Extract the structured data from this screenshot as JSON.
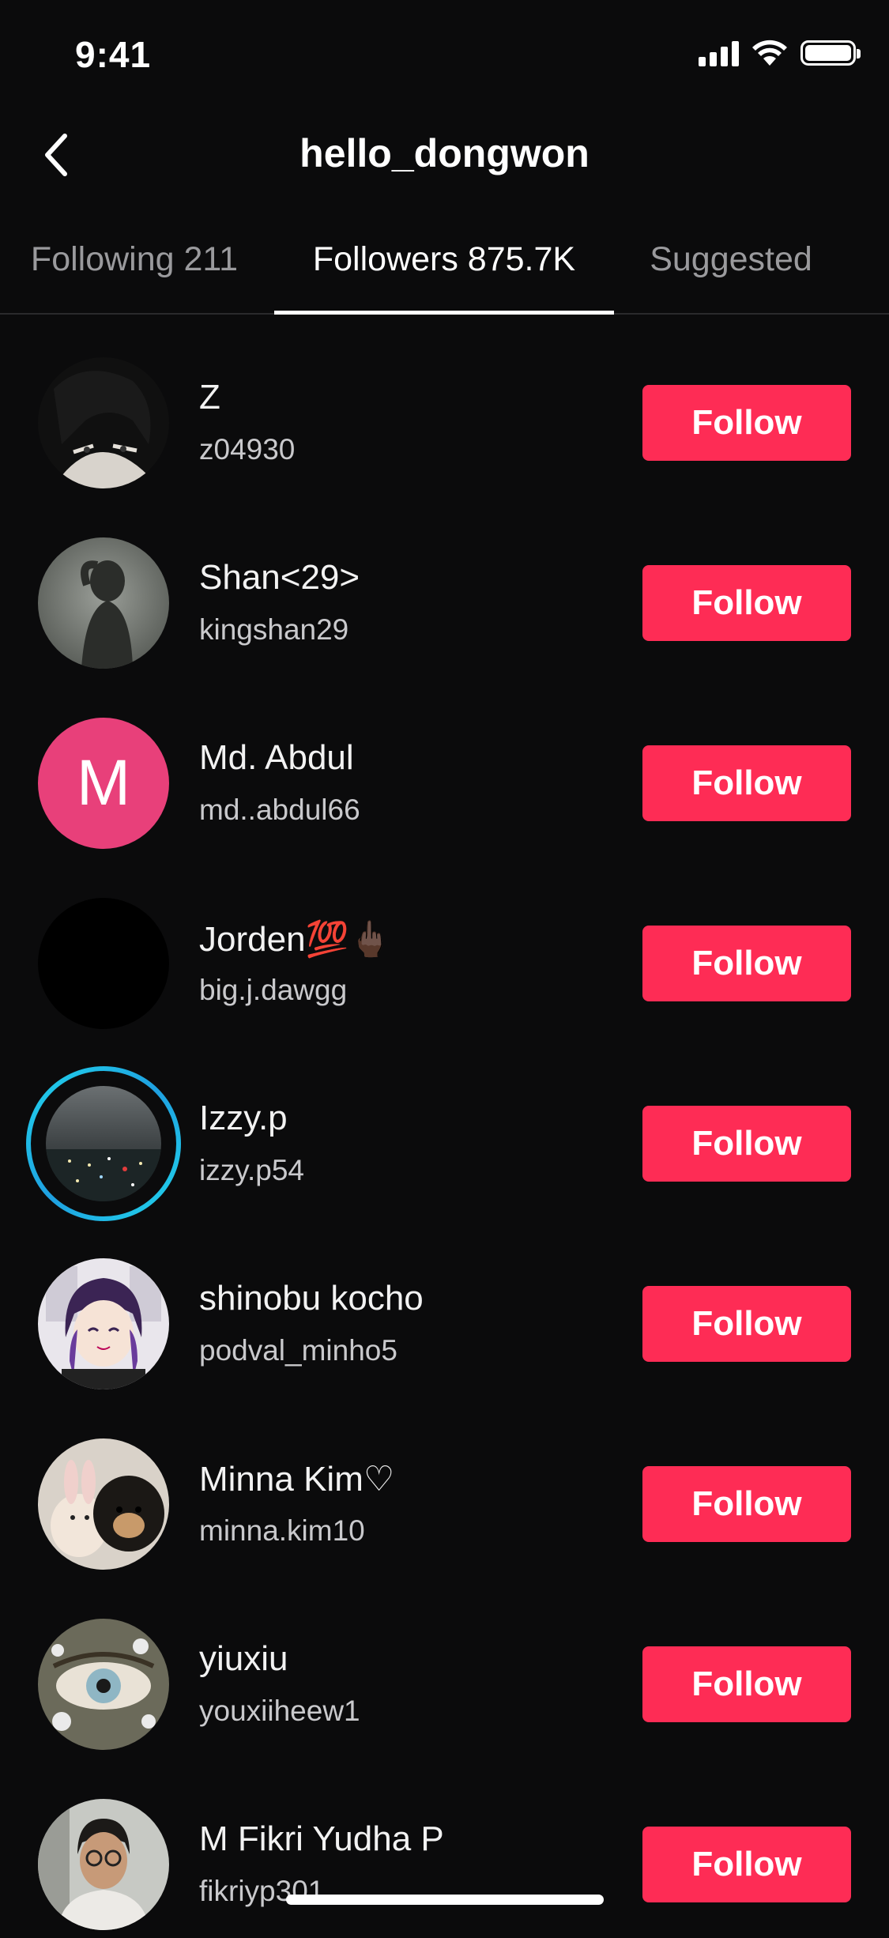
{
  "status_bar": {
    "time": "9:41"
  },
  "header": {
    "title": "hello_dongwon"
  },
  "tabs": [
    {
      "label": "Following 211",
      "active": false
    },
    {
      "label": "Followers 875.7K",
      "active": true
    },
    {
      "label": "Suggested",
      "active": false
    }
  ],
  "follow_label": "Follow",
  "followers": [
    {
      "name": "Z",
      "handle": "z04930",
      "avatar": "dark-anime-portrait"
    },
    {
      "name": "Shan<29>",
      "handle": "kingshan29",
      "avatar": "silhouette-photo"
    },
    {
      "name": "Md. Abdul",
      "handle": "md..abdul66",
      "avatar_letter": "M",
      "avatar": "letter"
    },
    {
      "name": "Jorden💯🖕🏿",
      "handle": "big.j.dawgg",
      "avatar": "black"
    },
    {
      "name": "Izzy.p",
      "handle": "izzy.p54",
      "avatar": "night-city-photo",
      "story_ring": true
    },
    {
      "name": "shinobu kocho",
      "handle": "podval_minho5",
      "avatar": "anime-girl"
    },
    {
      "name": "Minna Kim♡",
      "handle": "minna.kim10",
      "avatar": "bunny-and-dog-photo"
    },
    {
      "name": "yiuxiu",
      "handle": "youxiiheew1",
      "avatar": "eye-closeup-photo"
    },
    {
      "name": "M Fikri Yudha P",
      "handle": "fikriyp301",
      "avatar": "man-with-glasses-photo"
    }
  ],
  "colors": {
    "background": "#0b0b0c",
    "follow_button": "#fe2c55",
    "story_ring": "#20d5ec",
    "letter_avatar": "#e8407a"
  }
}
